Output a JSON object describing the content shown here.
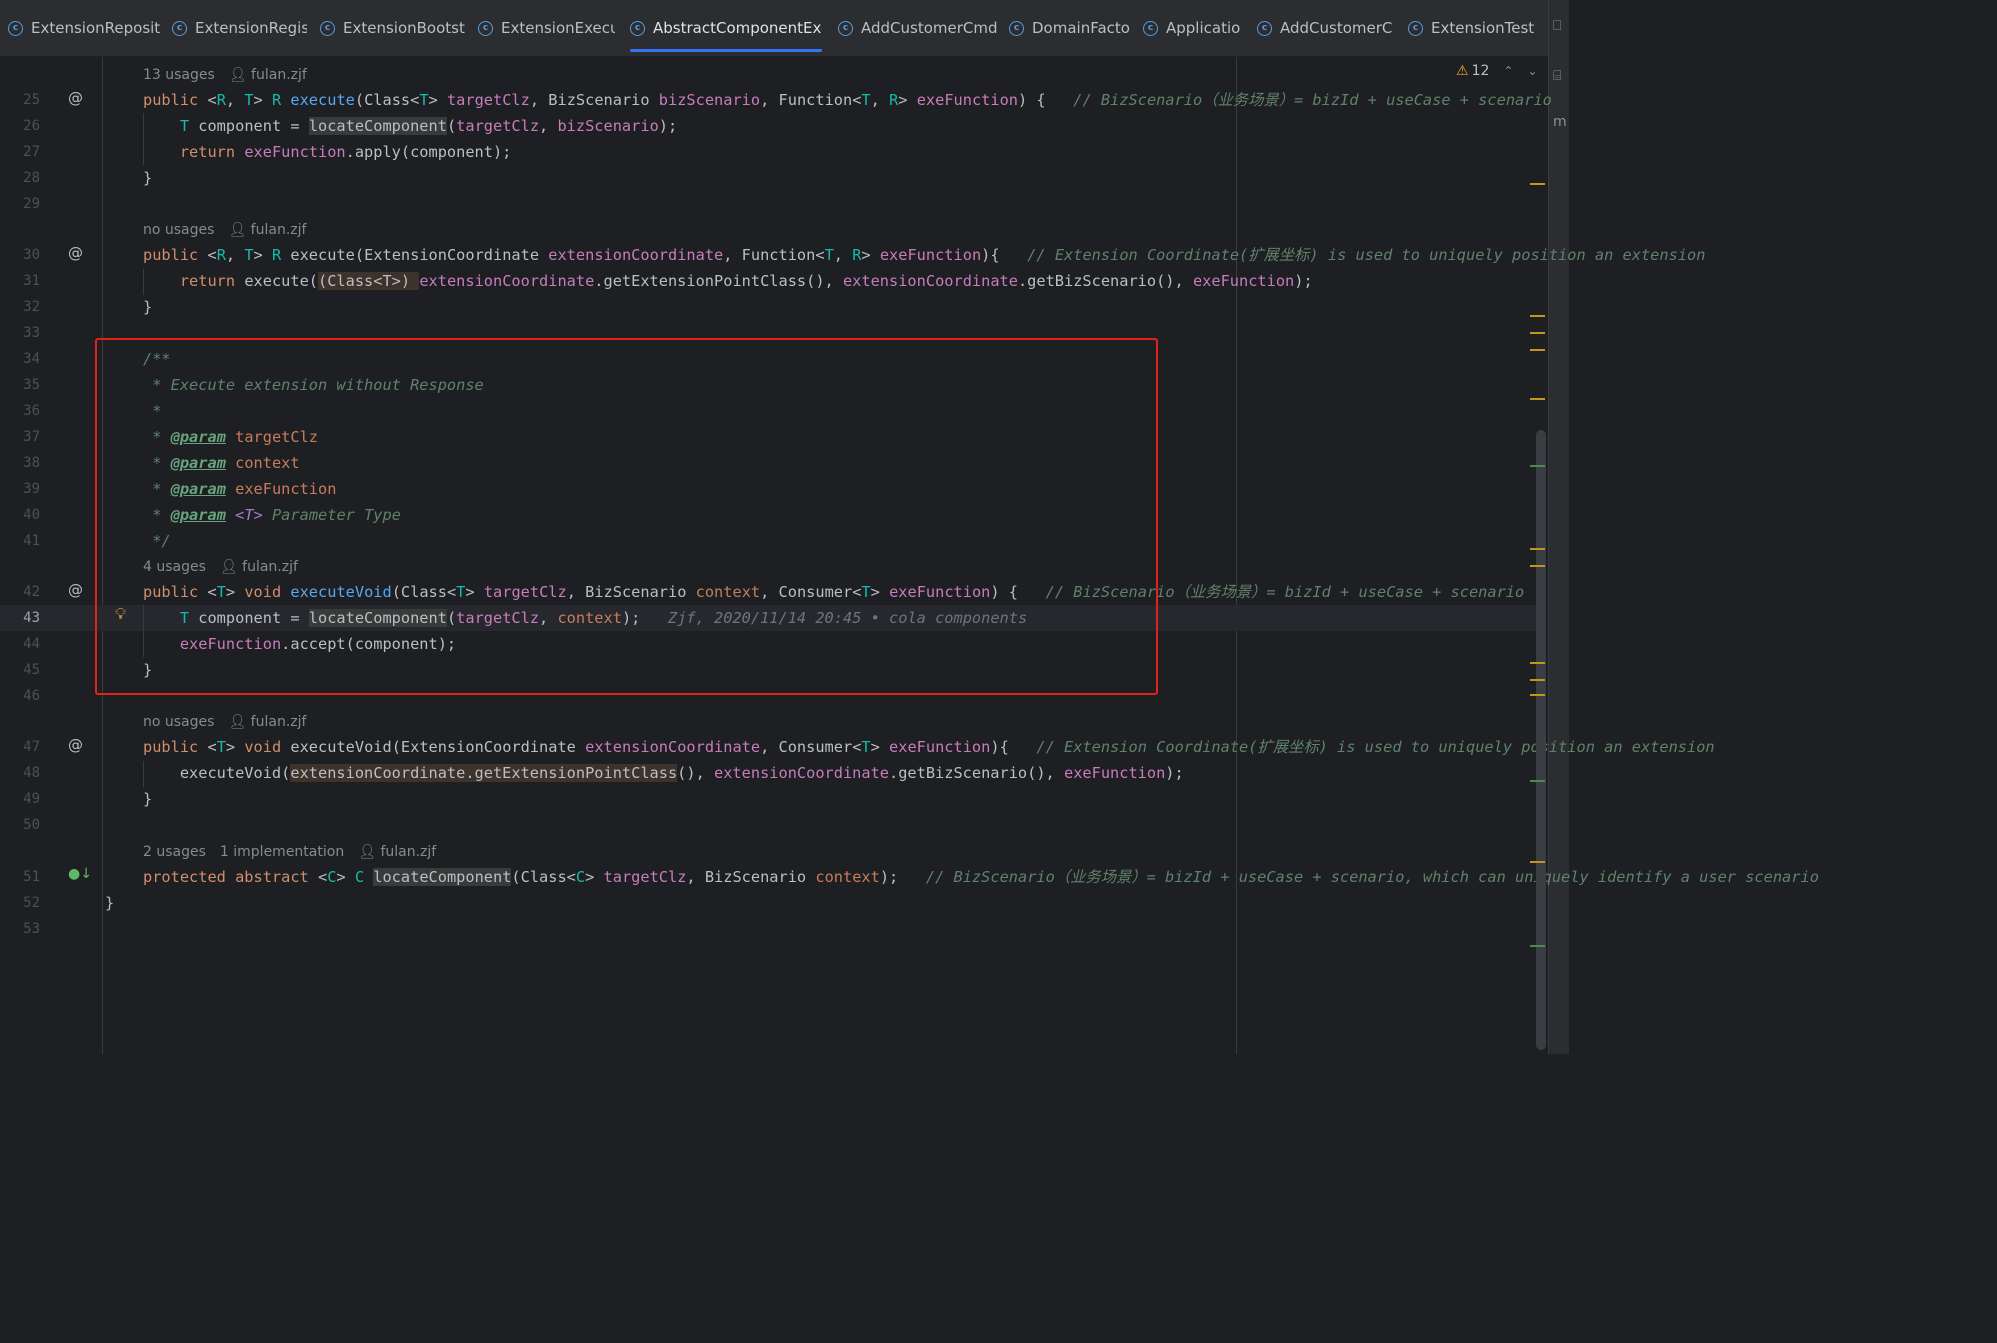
{
  "tabs": [
    {
      "label": "ExtensionReposit",
      "icon": "class-icon"
    },
    {
      "label": "ExtensionRegis",
      "icon": "class-icon"
    },
    {
      "label": "ExtensionBootst",
      "icon": "class-icon"
    },
    {
      "label": "ExtensionExecu",
      "icon": "class-icon"
    },
    {
      "label": "AbstractComponentExe",
      "icon": "class-icon",
      "active": true
    },
    {
      "label": "AddCustomerCmd",
      "icon": "class-icon"
    },
    {
      "label": "DomainFacto",
      "icon": "class-icon"
    },
    {
      "label": "Applicatio",
      "icon": "class-icon"
    },
    {
      "label": "AddCustomerC",
      "icon": "class-icon"
    },
    {
      "label": "ExtensionTest",
      "icon": "class-icon"
    }
  ],
  "inspection": {
    "warning_count": "12"
  },
  "inlays": {
    "i25": {
      "usages": "13 usages",
      "author": "fulan.zjf"
    },
    "i30": {
      "usages": "no usages",
      "author": "fulan.zjf"
    },
    "i42": {
      "usages": "4 usages",
      "author": "fulan.zjf"
    },
    "i47": {
      "usages": "no usages",
      "author": "fulan.zjf"
    },
    "i51": {
      "usages": "2 usages",
      "implementations": "1 implementation",
      "author": "fulan.zjf"
    }
  },
  "blame": {
    "line43": "Zjf, 2020/11/14 20:45 • cola components"
  },
  "line_numbers": [
    "25",
    "26",
    "27",
    "28",
    "29",
    "30",
    "31",
    "32",
    "33",
    "34",
    "35",
    "36",
    "37",
    "38",
    "39",
    "40",
    "41",
    "42",
    "43",
    "44",
    "45",
    "46",
    "47",
    "48",
    "49",
    "50",
    "51",
    "52",
    "53"
  ],
  "code": {
    "l25": [
      [
        "kw",
        "public "
      ],
      [
        "",
        "<"
      ],
      [
        "tp",
        "R"
      ],
      [
        "",
        ", "
      ],
      [
        "tp",
        "T"
      ],
      [
        "",
        "> "
      ],
      [
        "tp",
        "R "
      ],
      [
        "fn",
        "execute"
      ],
      [
        "",
        "(Class<"
      ],
      [
        "tp",
        "T"
      ],
      [
        "",
        "> "
      ],
      [
        "pa",
        "targetClz"
      ],
      [
        "",
        ", BizScenario "
      ],
      [
        "pa",
        "bizScenario"
      ],
      [
        "",
        ", Function<"
      ],
      [
        "tp",
        "T"
      ],
      [
        "",
        ", "
      ],
      [
        "tp",
        "R"
      ],
      [
        "",
        "> "
      ],
      [
        "pa",
        "exeFunction"
      ],
      [
        "",
        ") {   "
      ],
      [
        "cm",
        "// BizScenario（业务场景）= bizId + useCase + scenario"
      ]
    ],
    "l26": [
      [
        "",
        "    "
      ],
      [
        "tp",
        "T "
      ],
      [
        "",
        "component = "
      ],
      [
        "hl",
        "locateComponent"
      ],
      [
        "",
        "("
      ],
      [
        "pa",
        "targetClz"
      ],
      [
        "",
        ", "
      ],
      [
        "pa",
        "bizScenario"
      ],
      [
        "",
        ");"
      ]
    ],
    "l27": [
      [
        "",
        "    "
      ],
      [
        "kw",
        "return "
      ],
      [
        "pa",
        "exeFunction"
      ],
      [
        "",
        ".apply(component);"
      ]
    ],
    "l28": [
      [
        "",
        "}"
      ]
    ],
    "l29": [],
    "l30": [
      [
        "kw",
        "public "
      ],
      [
        "",
        "<"
      ],
      [
        "tp",
        "R"
      ],
      [
        "",
        ", "
      ],
      [
        "tp",
        "T"
      ],
      [
        "",
        "> "
      ],
      [
        "tp",
        "R "
      ],
      [
        "",
        "execute(ExtensionCoordinate "
      ],
      [
        "pa",
        "extensionCoordinate"
      ],
      [
        "",
        ", Function<"
      ],
      [
        "tp",
        "T"
      ],
      [
        "",
        ", "
      ],
      [
        "tp",
        "R"
      ],
      [
        "",
        "> "
      ],
      [
        "pa",
        "exeFunction"
      ],
      [
        "",
        "){   "
      ],
      [
        "cm",
        "// Extension Coordinate(扩展坐标) is used to uniquely position an extension"
      ]
    ],
    "l31": [
      [
        "",
        "    "
      ],
      [
        "kw",
        "return "
      ],
      [
        "",
        "execute("
      ],
      [
        "hlp",
        "(Class<T>) "
      ],
      [
        "pa",
        "extensionCoordinate"
      ],
      [
        "",
        ".getExtensionPointClass()"
      ],
      [
        "",
        ", "
      ],
      [
        "pa",
        "extensionCoordinate"
      ],
      [
        "",
        ".getBizScenario(), "
      ],
      [
        "pa",
        "exeFunction"
      ],
      [
        "",
        ");"
      ]
    ],
    "l32": [
      [
        "",
        "}"
      ]
    ],
    "l33": [],
    "l34": [
      [
        "dc",
        "/**"
      ]
    ],
    "l35": [
      [
        "dc",
        " * Execute extension without Response"
      ]
    ],
    "l36": [
      [
        "dc",
        " *"
      ]
    ],
    "l37": [
      [
        "dc",
        " * "
      ],
      [
        "tag",
        "@param"
      ],
      [
        "dc",
        " "
      ],
      [
        "pm",
        "targetClz"
      ]
    ],
    "l38": [
      [
        "dc",
        " * "
      ],
      [
        "tag",
        "@param"
      ],
      [
        "dc",
        " "
      ],
      [
        "pm",
        "context"
      ]
    ],
    "l39": [
      [
        "dc",
        " * "
      ],
      [
        "tag",
        "@param"
      ],
      [
        "dc",
        " "
      ],
      [
        "pm",
        "exeFunction"
      ]
    ],
    "l40": [
      [
        "dc",
        " * "
      ],
      [
        "tag",
        "@param"
      ],
      [
        "dc",
        " "
      ],
      [
        "pnm",
        "<T>"
      ],
      [
        "dc",
        " Parameter Type"
      ]
    ],
    "l41": [
      [
        "dc",
        " */"
      ]
    ],
    "l42": [
      [
        "kw",
        "public "
      ],
      [
        "",
        "<"
      ],
      [
        "tp",
        "T"
      ],
      [
        "",
        "> "
      ],
      [
        "kw",
        "void "
      ],
      [
        "fn",
        "executeVoid"
      ],
      [
        "",
        "(Class<"
      ],
      [
        "tp",
        "T"
      ],
      [
        "",
        "> "
      ],
      [
        "pa",
        "targetClz"
      ],
      [
        "",
        ", BizScenario "
      ],
      [
        "pm",
        "context"
      ],
      [
        "",
        ", Consumer<"
      ],
      [
        "tp",
        "T"
      ],
      [
        "",
        "> "
      ],
      [
        "pa",
        "exeFunction"
      ],
      [
        "",
        ") {   "
      ],
      [
        "cm",
        "// BizScenario（业务场景）= bizId + useCase + scenario"
      ]
    ],
    "l43": [
      [
        "",
        "    "
      ],
      [
        "tp",
        "T "
      ],
      [
        "",
        "component = "
      ],
      [
        "hl",
        "locateComponent"
      ],
      [
        "",
        "("
      ],
      [
        "pa",
        "targetClz"
      ],
      [
        "",
        ", "
      ],
      [
        "pm",
        "context"
      ],
      [
        "",
        ");   "
      ],
      [
        "blame",
        "Zjf, 2020/11/14 20:45 • cola components"
      ]
    ],
    "l44": [
      [
        "",
        "    "
      ],
      [
        "pa",
        "exeFunction"
      ],
      [
        "",
        ".accept(component);"
      ]
    ],
    "l45": [
      [
        "",
        "}"
      ]
    ],
    "l46": [],
    "l47": [
      [
        "kw",
        "public "
      ],
      [
        "",
        "<"
      ],
      [
        "tp",
        "T"
      ],
      [
        "",
        "> "
      ],
      [
        "kw",
        "void "
      ],
      [
        "",
        "executeVoid(ExtensionCoordinate "
      ],
      [
        "pa",
        "extensionCoordinate"
      ],
      [
        "",
        ", Consumer<"
      ],
      [
        "tp",
        "T"
      ],
      [
        "",
        "> "
      ],
      [
        "pa",
        "exeFunction"
      ],
      [
        "",
        "){   "
      ],
      [
        "cm",
        "// Extension Coordinate(扩展坐标) is used to uniquely position an extension"
      ]
    ],
    "l48": [
      [
        "",
        "    executeVoid("
      ],
      [
        "hlp",
        "extensionCoordinate.getExtensionPointClass"
      ],
      [
        "",
        "(), "
      ],
      [
        "pa",
        "extensionCoordinate"
      ],
      [
        "",
        ".getBizScenario(), "
      ],
      [
        "pa",
        "exeFunction"
      ],
      [
        "",
        ");"
      ]
    ],
    "l49": [
      [
        "",
        "}"
      ]
    ],
    "l50": [],
    "l51": [
      [
        "kw",
        "protected abstract "
      ],
      [
        "",
        "<"
      ],
      [
        "tp",
        "C"
      ],
      [
        "",
        "> "
      ],
      [
        "tp",
        "C "
      ],
      [
        "hl",
        "locateComponent"
      ],
      [
        "",
        "(Class<"
      ],
      [
        "tp",
        "C"
      ],
      [
        "",
        "> "
      ],
      [
        "pa",
        "targetClz"
      ],
      [
        "",
        ", BizScenario "
      ],
      [
        "pm",
        "context"
      ],
      [
        "",
        ");   "
      ],
      [
        "cm",
        "// BizScenario（业务场景）= bizId + useCase + scenario, which can uniquely identify a user scenario"
      ]
    ],
    "l52": [
      [
        "",
        "}"
      ]
    ],
    "l53": []
  },
  "colors": {
    "accent": "#3574f0",
    "highlight_box": "#e0221a",
    "warning": "#f0a732"
  },
  "icons": {
    "override": "at-override-icon",
    "implemented": "implemented-down-icon",
    "bulb": "lightbulb-icon",
    "warning": "warning-triangle-icon"
  }
}
